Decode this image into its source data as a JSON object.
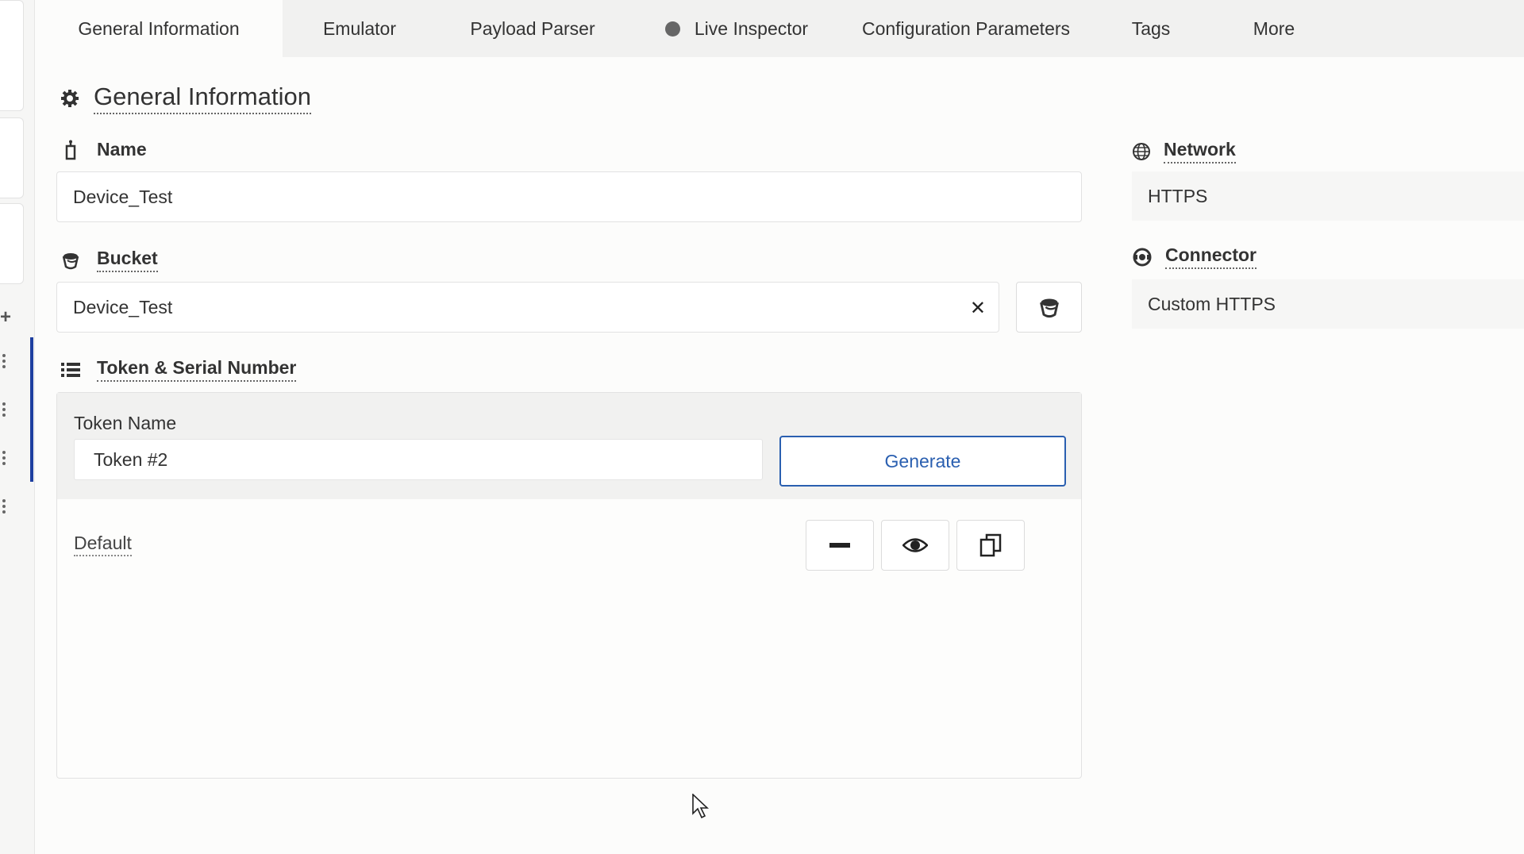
{
  "tabs": [
    {
      "label": "General Information",
      "active": true
    },
    {
      "label": "Emulator"
    },
    {
      "label": "Payload Parser"
    },
    {
      "label": "Live Inspector",
      "status_dot": true
    },
    {
      "label": "Configuration Parameters"
    },
    {
      "label": "Tags"
    },
    {
      "label": "More"
    }
  ],
  "section": {
    "title": "General Information",
    "icon": "gear-icon"
  },
  "name_field": {
    "label": "Name",
    "icon": "device-icon",
    "value": "Device_Test"
  },
  "bucket_field": {
    "label": "Bucket",
    "icon": "bucket-icon",
    "value": "Device_Test",
    "clear_icon": "close-icon",
    "picker_icon": "bucket-icon"
  },
  "token": {
    "title": "Token & Serial Number",
    "icon": "list-icon",
    "name_label": "Token Name",
    "name_value": "Token #2",
    "generate_label": "Generate",
    "default_label": "Default",
    "actions": [
      "remove-icon",
      "eye-icon",
      "copy-icon"
    ]
  },
  "network": {
    "label": "Network",
    "icon": "globe-icon",
    "value": "HTTPS"
  },
  "connector": {
    "label": "Connector",
    "icon": "connector-icon",
    "value": "Custom HTTPS"
  },
  "colors": {
    "accent": "#2a5fb0",
    "rail_active": "#1e3fa0"
  }
}
